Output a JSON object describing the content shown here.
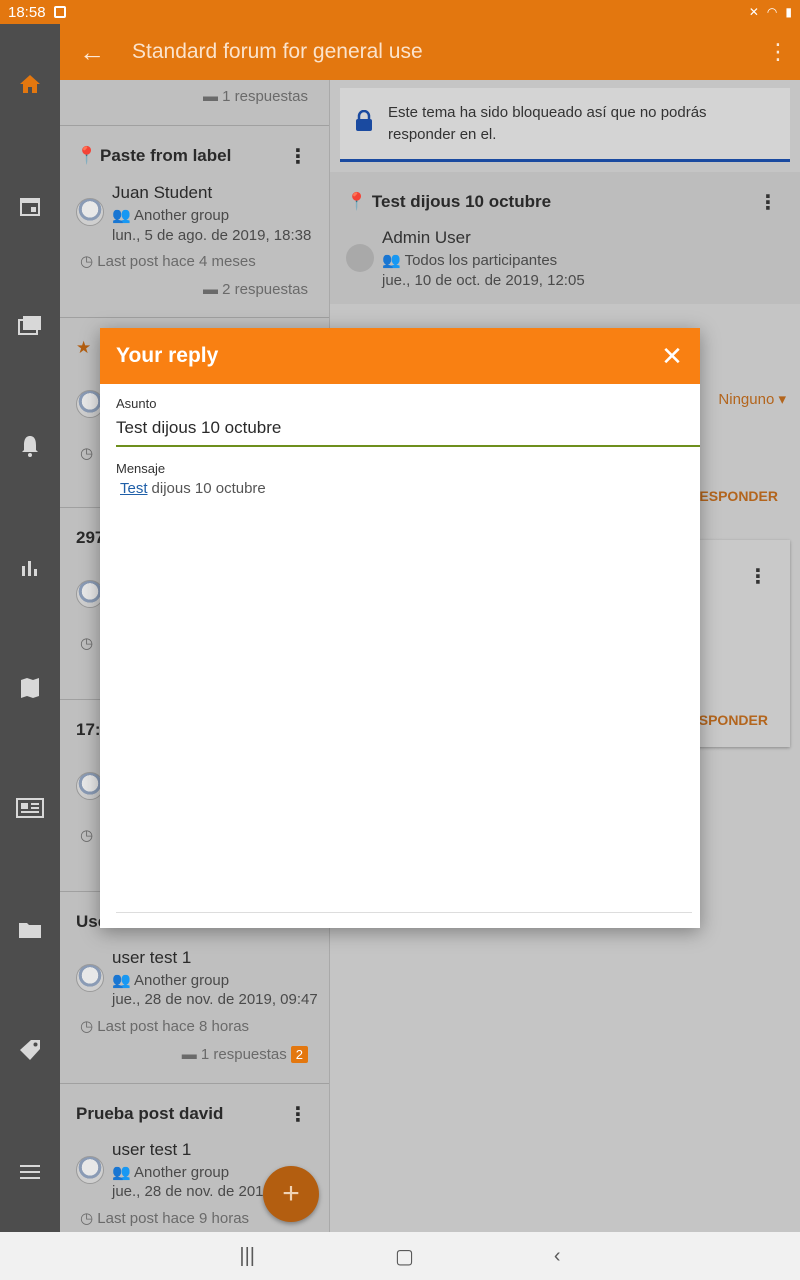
{
  "statusbar": {
    "time": "18:58"
  },
  "header": {
    "title": "Standard forum for general use"
  },
  "sidemenu": {
    "items": [
      "home-icon",
      "calendar-icon",
      "forums-icon",
      "notifications-icon",
      "grades-icon",
      "map-icon",
      "news-icon",
      "files-icon",
      "tags-icon",
      "menu-icon"
    ]
  },
  "discussions": [
    {
      "replies": "1 respuestas"
    },
    {
      "title": "Paste from label",
      "author": "Juan Student",
      "group": "Another group",
      "date": "lun., 5 de ago. de 2019, 18:38",
      "lastpost": "Last post hace 4 meses",
      "replies": "2 respuestas"
    },
    {
      "title": "297"
    },
    {
      "title": "17:"
    },
    {
      "title": "Use",
      "author": "user test 1",
      "group": "Another group",
      "date": "jue., 28 de nov. de 2019, 09:47",
      "lastpost": "Last post hace 8 horas",
      "replies": "1 respuestas",
      "unread": "2"
    },
    {
      "title": "Prueba post david",
      "author": "user test 1",
      "group": "Another group",
      "date": "jue., 28 de nov. de 2019",
      "lastpost": "Last post hace 9 horas"
    }
  ],
  "detail": {
    "locked_notice": "Este tema ha sido bloqueado así que no podrás responder en el.",
    "post": {
      "title": "Test dijous 10 octubre",
      "author": "Admin User",
      "group": "Todos los participantes",
      "date": "jue., 10 de oct. de 2019, 12:05"
    },
    "sort_label": "Ninguno",
    "reply_label_1": "RESPONDER",
    "reply_label_2": "ESPONDER"
  },
  "modal": {
    "title": "Your reply",
    "subject_label": "Asunto",
    "subject_value": "Test dijous 10 octubre",
    "message_label": "Mensaje",
    "message_link": "Test",
    "message_rest": "dijous 10 octubre"
  },
  "colors": {
    "primary": "#f98012",
    "dark_primary": "#e3770f",
    "link": "#1f5fa8",
    "input_underline": "#6e8f1d"
  }
}
